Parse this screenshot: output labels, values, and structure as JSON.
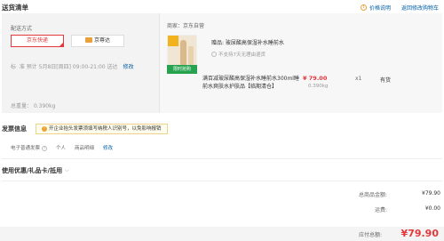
{
  "header": {
    "title": "送货清单",
    "price_note": "价格说明",
    "back_to_cart": "返回修改购物车"
  },
  "shipping": {
    "label": "配送方式",
    "options": [
      {
        "label": "京东快递",
        "selected": true
      },
      {
        "label": "京尊达",
        "selected": false
      }
    ],
    "time_label": "标",
    "time_value": "准  预计 5月8日[周四] 09:00-21:00 送达",
    "edit": "修改",
    "weight_label": "总重量：",
    "weight_value": "0.390kg"
  },
  "product": {
    "seller": "商家：京东自营",
    "thumb_badge": "限时抢购",
    "gift_label": "赠品: 玻尿酸高保湿补水睡前水",
    "no_return": "不支持7天无理由退货",
    "name": "满百减玻尿酸高保湿补水睡前水300ml睡前水爽肤水护肤品【临期清仓】",
    "price": "¥ 79.00",
    "weight": "0.390kg",
    "qty": "x1",
    "stock": "有货"
  },
  "invoice": {
    "title": "发票信息",
    "notice": "开企业抬头发票须填写纳税人识别号，以免影响报销",
    "type": "电子普通发票",
    "holder": "个人",
    "content": "商品明细",
    "edit": "修改"
  },
  "coupon": {
    "title": "使用优惠/礼品卡/抵用"
  },
  "summary": {
    "rows": [
      {
        "label": "总商品金额:",
        "value": "¥79.90"
      },
      {
        "label": "运费:",
        "value": "¥0.00"
      }
    ],
    "total_label": "应付总额:",
    "total_value": "¥79.90"
  },
  "colors": {
    "accent": "#e4393c",
    "link": "#005ea7"
  }
}
